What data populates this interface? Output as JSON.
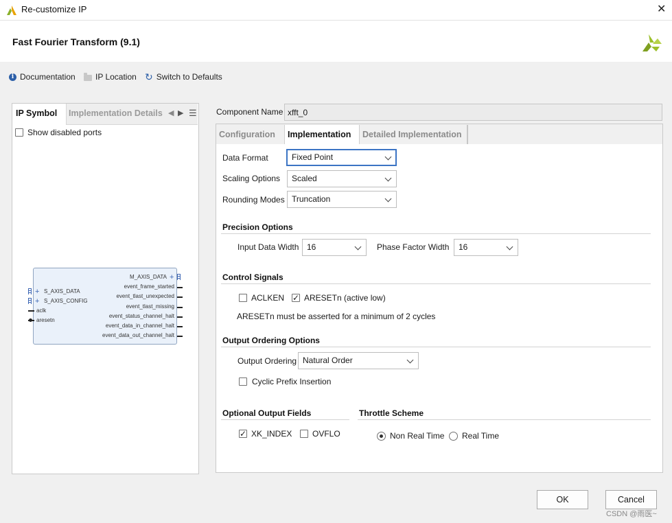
{
  "window": {
    "title": "Re-customize IP",
    "close_glyph": "✕"
  },
  "header": {
    "title": "Fast Fourier Transform (9.1)"
  },
  "toolbar": {
    "documentation": "Documentation",
    "ip_location": "IP Location",
    "switch_defaults": "Switch to Defaults"
  },
  "left_panel": {
    "tabs": [
      "IP Symbol",
      "Implementation Details"
    ],
    "show_disabled_ports": "Show disabled ports"
  },
  "ip_symbol": {
    "left_ports": [
      "S_AXIS_DATA",
      "S_AXIS_CONFIG",
      "aclk",
      "aresetn"
    ],
    "right_ports": [
      "M_AXIS_DATA",
      "event_frame_started",
      "event_tlast_unexpected",
      "event_tlast_missing",
      "event_status_channel_halt",
      "event_data_in_channel_halt",
      "event_data_out_channel_halt"
    ]
  },
  "component": {
    "label": "Component Name",
    "value": "xfft_0"
  },
  "tabs": [
    "Configuration",
    "Implementation",
    "Detailed Implementation"
  ],
  "implementation": {
    "data_format": {
      "label": "Data Format",
      "value": "Fixed Point"
    },
    "scaling": {
      "label": "Scaling Options",
      "value": "Scaled"
    },
    "rounding": {
      "label": "Rounding Modes",
      "value": "Truncation"
    },
    "precision": {
      "title": "Precision Options",
      "input_width": {
        "label": "Input Data Width",
        "value": "16"
      },
      "phase_width": {
        "label": "Phase Factor Width",
        "value": "16"
      }
    },
    "control": {
      "title": "Control Signals",
      "aclken": "ACLKEN",
      "aresetn": "ARESETn (active low)",
      "note": "ARESETn must be asserted for a minimum of 2 cycles"
    },
    "output_ordering": {
      "title": "Output Ordering Options",
      "label": "Output Ordering",
      "value": "Natural Order",
      "cyclic_prefix": "Cyclic Prefix Insertion"
    },
    "optional_fields": {
      "title": "Optional Output Fields",
      "xk_index": "XK_INDEX",
      "ovflo": "OVFLO"
    },
    "throttle": {
      "title": "Throttle Scheme",
      "non_real_time": "Non Real Time",
      "real_time": "Real Time"
    }
  },
  "buttons": {
    "ok": "OK",
    "cancel": "Cancel"
  },
  "watermark": "CSDN @雨医~",
  "colors": {
    "accent": "#3b74c4",
    "xilinx_logo": "#9bbf2a"
  }
}
